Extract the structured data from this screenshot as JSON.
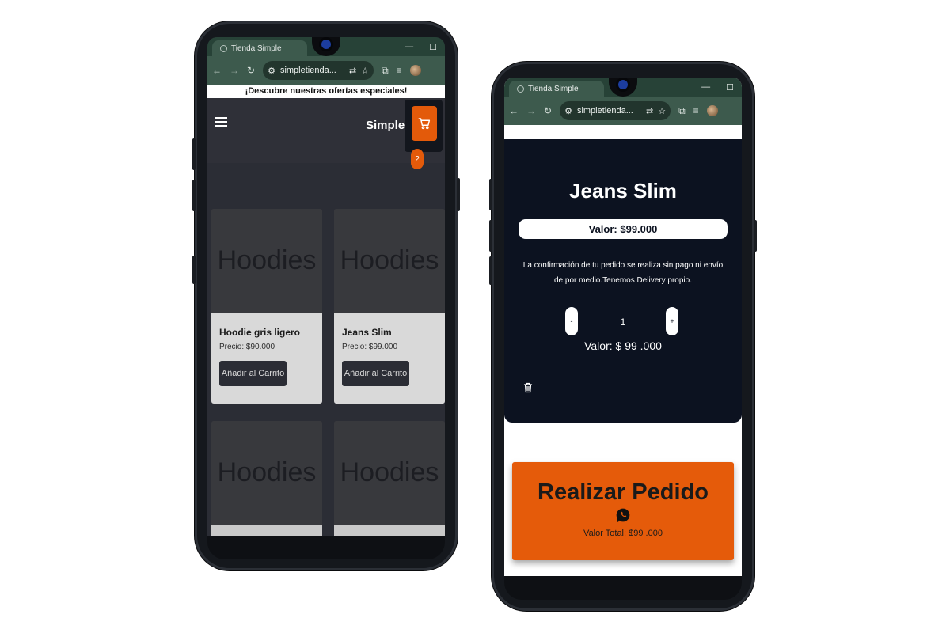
{
  "left_phone": {
    "browser": {
      "tab_title": "Tienda Simple",
      "url": "simpletienda...",
      "new_tab_symbol": "+",
      "minimize_symbol": "—",
      "maximize_symbol": "☐"
    },
    "promo_banner": "¡Descubre nuestras ofertas especiales!",
    "header": {
      "brand": "Simple",
      "cart_count": "2",
      "menu_icon": "hamburger-icon",
      "cart_icon": "cart-icon"
    },
    "products": [
      {
        "image_text": "Hoodies",
        "name": "Hoodie gris ligero",
        "price": "Precio: $90.000",
        "button": "Añadir al Carrito"
      },
      {
        "image_text": "Hoodies",
        "name": "Jeans Slim",
        "price": "Precio: $99.000",
        "button": "Añadir al Carrito"
      },
      {
        "image_text": "Hoodies"
      },
      {
        "image_text": "Hoodies"
      }
    ]
  },
  "right_phone": {
    "browser": {
      "tab_title": "Tienda Simple",
      "url": "simpletienda...",
      "new_tab_symbol": "+",
      "minimize_symbol": "—",
      "maximize_symbol": "☐"
    },
    "cart_item": {
      "title": "Jeans Slim",
      "value": "Valor: $99.000",
      "notice": "La confirmación de tu pedido se realiza sin pago ni envío de por medio.Tenemos Delivery propio.",
      "decrement": "-",
      "quantity": "1",
      "increment": "+",
      "line_total": "Valor: $ 99 .000",
      "remove_icon": "trash-icon"
    },
    "order": {
      "button": "Realizar Pedido",
      "icon": "whatsapp-icon",
      "total": "Valor Total: $99 .000"
    }
  },
  "colors": {
    "accent": "#e55b0a",
    "browser_frame": "#3d5a4d",
    "dark_panel": "#0c1220"
  }
}
